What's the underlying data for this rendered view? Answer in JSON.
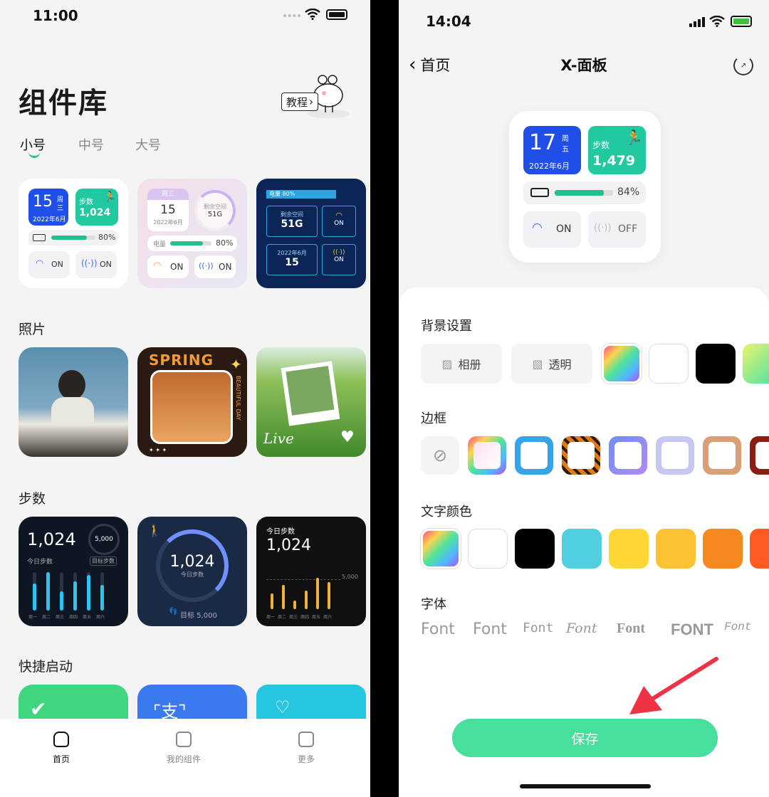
{
  "left": {
    "status_time": "11:00",
    "title": "组件库",
    "tutorial_label": "教程",
    "tabs": [
      "小号",
      "中号",
      "大号"
    ],
    "sections": {
      "photos": "照片",
      "steps": "步数",
      "shortcuts": "快捷启动"
    },
    "widget1": {
      "day": "15",
      "week": "周",
      "week2": "三",
      "date": "2022年6月",
      "steps_label": "步数",
      "steps": "1,024",
      "battery_pct": "80%",
      "battery_fraction": 0.8,
      "wifi": "ON",
      "cell": "ON"
    },
    "widget2": {
      "week": "周三",
      "day": "15",
      "date": "2022年6月",
      "space_label": "剩余空间",
      "space": "51G",
      "power_label": "电量",
      "power_pct": "80%",
      "wifi": "ON",
      "cell": "ON"
    },
    "widget3": {
      "power": "电量 80%",
      "space_label": "剩余空间",
      "space": "51G",
      "wifi": "ON",
      "date": "2022年6月",
      "day": "15",
      "cell": "ON"
    },
    "photo2": {
      "spring": "SPRING",
      "side": "BEAUTIFUL DAY"
    },
    "photo3": {
      "live": "Live"
    },
    "step1": {
      "count": "1,024",
      "goal": "5,000",
      "today": "今日步数",
      "goal_label": "目标步数",
      "days": [
        "周一",
        "周二",
        "周三",
        "周四",
        "周五",
        "周六"
      ]
    },
    "step2": {
      "count": "1,024",
      "today": "今日步数",
      "goal": "目标 5,000"
    },
    "step3": {
      "label": "今日步数",
      "count": "1,024",
      "goal": "5,000",
      "days": [
        "周一",
        "周二",
        "周三",
        "周四",
        "周五",
        "周六"
      ]
    },
    "nav": [
      {
        "label": "首页"
      },
      {
        "label": "我的组件"
      },
      {
        "label": "更多"
      }
    ],
    "colors": {
      "accent": "#22c08a",
      "widget_blue": "#1f4fe8"
    }
  },
  "right": {
    "status_time": "14:04",
    "back_label": "首页",
    "title": "X-面板",
    "preview": {
      "day": "17",
      "week": "周",
      "week2": "五",
      "date": "2022年6月",
      "steps_label": "步数",
      "steps": "1,479",
      "battery_pct": "84%",
      "battery_fraction": 0.84,
      "wifi": "ON",
      "cell": "OFF"
    },
    "bg_section": "背景设置",
    "bg_album": "相册",
    "bg_transparent": "透明",
    "border_section": "边框",
    "text_color_section": "文字颜色",
    "text_colors": [
      "#ffffff",
      "#000000",
      "#4fcfe0",
      "#ffd633",
      "#fcc233",
      "#f5891f",
      "#ff5a1f"
    ],
    "font_section": "字体",
    "fonts": [
      "Font",
      "Font",
      "Font",
      "Font",
      "Font",
      "FONT",
      "Font"
    ],
    "save_label": "保存",
    "colors": {
      "save": "#46df9c",
      "arrow": "#ee3344"
    }
  }
}
